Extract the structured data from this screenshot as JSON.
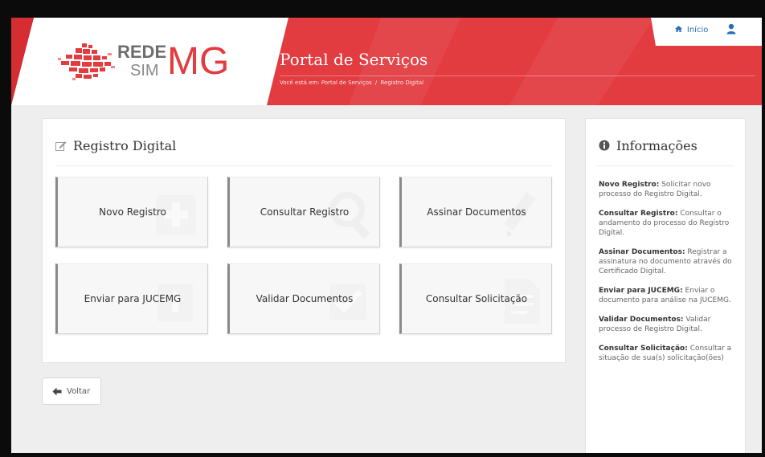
{
  "header": {
    "logo": {
      "line1": "REDE",
      "line2": "SIM",
      "mark": "MG"
    },
    "portal_title": "Portal de Serviços",
    "breadcrumb": {
      "prefix": "Você está em:",
      "items": [
        "Portal de Serviços",
        "Registro Digital"
      ],
      "separator": "/"
    },
    "topnav": {
      "home_label": "Início",
      "home_icon": "home-icon",
      "user_icon": "user-icon"
    },
    "colors": {
      "brand_red": "#e23b40",
      "link_blue": "#2a6ebb"
    }
  },
  "main": {
    "title": "Registro Digital",
    "title_icon": "edit-icon",
    "tiles": [
      {
        "label": "Novo Registro",
        "icon": "plus-icon"
      },
      {
        "label": "Consultar Registro",
        "icon": "magnifier-icon"
      },
      {
        "label": "Assinar Documentos",
        "icon": "pen-icon"
      },
      {
        "label": "Enviar para JUCEMG",
        "icon": "upload-icon"
      },
      {
        "label": "Validar Documentos",
        "icon": "check-icon"
      },
      {
        "label": "Consultar Solicitação",
        "icon": "document-icon"
      }
    ]
  },
  "info": {
    "title": "Informações",
    "title_icon": "info-icon",
    "items": [
      {
        "term": "Novo Registro:",
        "desc": "Solicitar novo processo do Registro Digital."
      },
      {
        "term": "Consultar Registro:",
        "desc": "Consultar o andamento do processo do Registro Digital."
      },
      {
        "term": "Assinar Documentos:",
        "desc": "Registrar a assinatura no documento através do Certificado Digital."
      },
      {
        "term": "Enviar para JUCEMG:",
        "desc": "Enviar o documento para análise na JUCEMG."
      },
      {
        "term": "Validar Documentos:",
        "desc": "Validar processo de Registro Digital."
      },
      {
        "term": "Consultar Solicitação:",
        "desc": "Consultar a situação de sua(s) solicitação(ões)"
      }
    ]
  },
  "back_button": {
    "label": "Voltar",
    "icon": "arrow-left-icon"
  }
}
